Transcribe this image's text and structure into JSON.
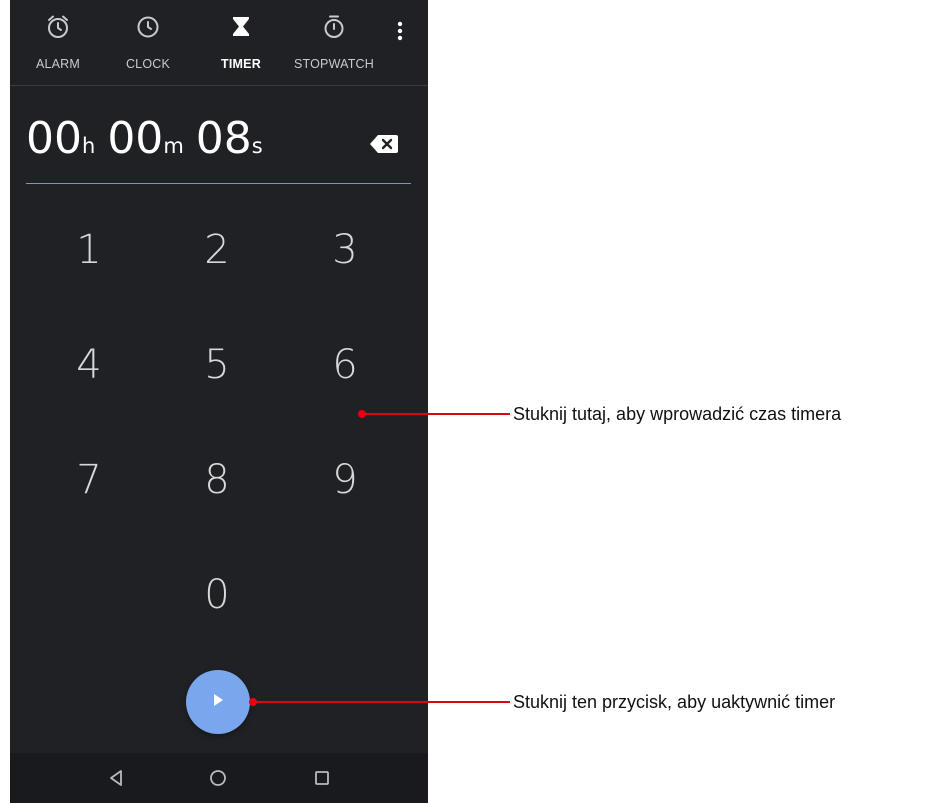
{
  "tabs": [
    {
      "label": "ALARM",
      "icon": "alarm-clock-icon",
      "active": false
    },
    {
      "label": "CLOCK",
      "icon": "clock-icon",
      "active": false
    },
    {
      "label": "TIMER",
      "icon": "hourglass-icon",
      "active": true
    },
    {
      "label": "STOPWATCH",
      "icon": "stopwatch-icon",
      "active": false
    }
  ],
  "menu_icon": "more-vert-icon",
  "timer": {
    "hours": "00",
    "hours_unit": "h",
    "minutes": "00",
    "minutes_unit": "m",
    "seconds": "08",
    "seconds_unit": "s"
  },
  "backspace_icon": "backspace-icon",
  "keypad": [
    "1",
    "2",
    "3",
    "4",
    "5",
    "6",
    "7",
    "8",
    "9",
    "0"
  ],
  "start_icon": "play-icon",
  "nav": {
    "back_icon": "back-triangle-icon",
    "home_icon": "home-circle-icon",
    "recents_icon": "recents-square-icon"
  },
  "annotations": {
    "keypad_note": "Stuknij tutaj, aby wprowadzić czas timera",
    "start_note": "Stuknij ten przycisk, aby uaktywnić timer"
  },
  "colors": {
    "background": "#202124",
    "accent": "#7aa6ee",
    "underline": "#6c97e6",
    "callout": "#e60012"
  }
}
